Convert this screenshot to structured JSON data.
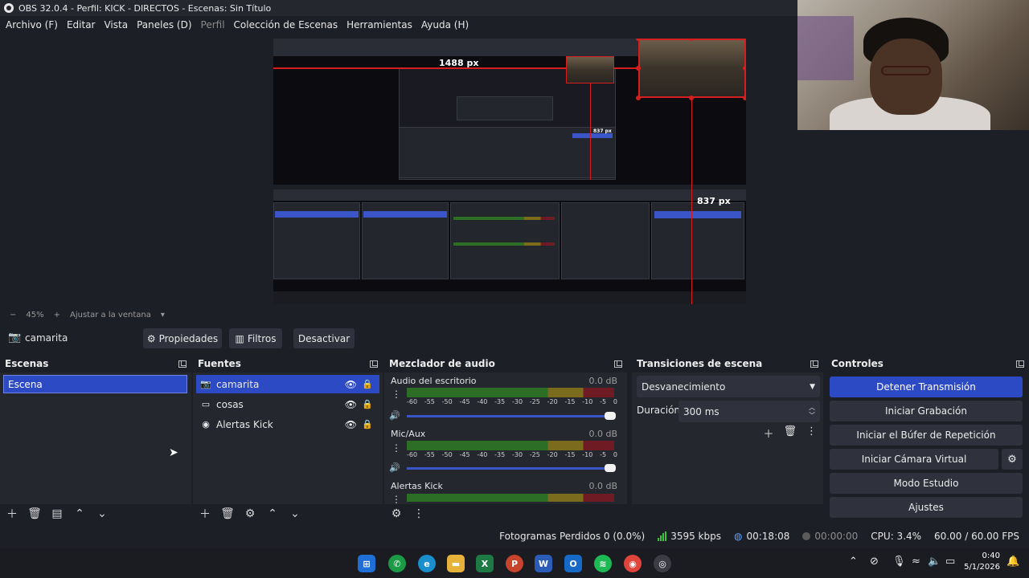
{
  "window": {
    "title": "OBS 32.0.4 - Perfil: KICK - DIRECTOS - Escenas: Sin Título"
  },
  "menu": [
    {
      "label": "Archivo (F)",
      "disabled": false
    },
    {
      "label": "Editar",
      "disabled": false
    },
    {
      "label": "Vista",
      "disabled": false
    },
    {
      "label": "Paneles (D)",
      "disabled": false
    },
    {
      "label": "Perfil",
      "disabled": true
    },
    {
      "label": "Colección de Escenas",
      "disabled": false
    },
    {
      "label": "Herramientas",
      "disabled": false
    },
    {
      "label": "Ayuda (H)",
      "disabled": false
    }
  ],
  "preview": {
    "guide_width_label": "1488 px",
    "guide_height_label": "837 px",
    "nested_width_label": "837 px"
  },
  "zoom": {
    "minus": "−",
    "value": "45%",
    "plus": "+",
    "fit_label": "Ajustar a la ventana"
  },
  "source_toolbar": {
    "selected_source": "camarita",
    "properties": "Propiedades",
    "filters": "Filtros",
    "deactivate": "Desactivar"
  },
  "scenes": {
    "title": "Escenas",
    "items": [
      "Escena"
    ]
  },
  "sources": {
    "title": "Fuentes",
    "items": [
      {
        "name": "camarita",
        "icon": "camera-icon",
        "selected": true
      },
      {
        "name": "cosas",
        "icon": "window-capture-icon",
        "selected": false
      },
      {
        "name": "Alertas Kick",
        "icon": "browser-icon",
        "selected": false
      }
    ]
  },
  "mixer": {
    "title": "Mezclador de audio",
    "ticks": [
      "-60",
      "-55",
      "-50",
      "-45",
      "-40",
      "-35",
      "-30",
      "-25",
      "-20",
      "-15",
      "-10",
      "-5",
      "0"
    ],
    "channels": [
      {
        "name": "Audio del escritorio",
        "db": "0.0 dB"
      },
      {
        "name": "Mic/Aux",
        "db": "0.0 dB"
      },
      {
        "name": "Alertas Kick",
        "db": "0.0 dB"
      }
    ]
  },
  "transitions": {
    "title": "Transiciones de escena",
    "selected": "Desvanecimiento",
    "duration_label": "Duración",
    "duration_value": "300 ms"
  },
  "controls": {
    "title": "Controles",
    "stop_stream": "Detener Transmisión",
    "start_recording": "Iniciar Grabación",
    "start_replay": "Iniciar el Búfer de Repetición",
    "start_virtualcam": "Iniciar Cámara Virtual",
    "studio_mode": "Modo Estudio",
    "settings": "Ajustes"
  },
  "status": {
    "dropped_frames": "Fotogramas Perdidos 0 (0.0%)",
    "bitrate": "3595 kbps",
    "stream_time": "00:18:08",
    "record_time": "00:00:00",
    "cpu": "CPU: 3.4%",
    "fps": "60.00 / 60.00 FPS"
  },
  "taskbar": {
    "time": "0:40",
    "date": "5/1/2026",
    "apps": [
      "windows-start-icon",
      "whatsapp-icon",
      "edge-icon",
      "file-explorer-icon",
      "excel-icon",
      "powerpoint-icon",
      "word-icon",
      "outlook-icon",
      "spotify-icon",
      "chrome-icon",
      "obs-icon"
    ]
  },
  "colors": {
    "accent": "#2c4ac4",
    "live_guide": "#d61e1e",
    "panel": "#25272f",
    "background": "#1d1f26"
  }
}
